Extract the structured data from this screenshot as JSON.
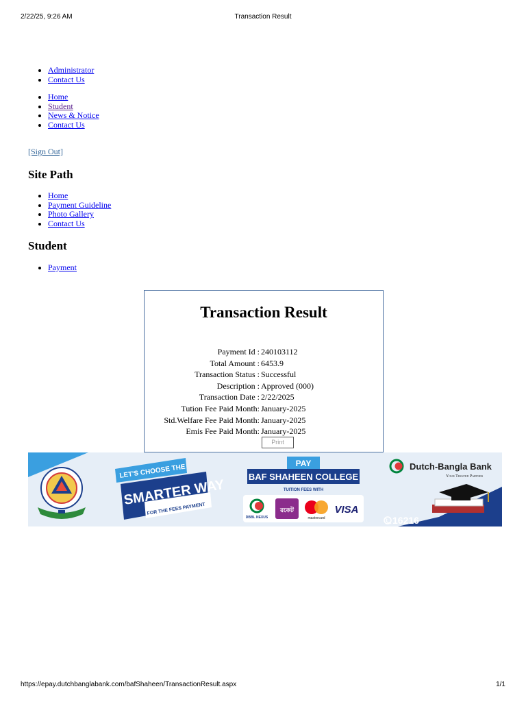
{
  "print_header": {
    "datetime": "2/22/25, 9:26 AM",
    "title": "Transaction Result"
  },
  "top_links": [
    "Administrator",
    "Contact Us"
  ],
  "main_menu": [
    "Home",
    "Student",
    "News & Notice",
    "Contact Us"
  ],
  "sign_out": "[Sign Out]",
  "site_path": {
    "heading": "Site Path",
    "items": [
      "Home",
      "Payment Guideline",
      "Photo Gallery",
      "Contact Us"
    ]
  },
  "student": {
    "heading": "Student",
    "items": [
      "Payment"
    ]
  },
  "transaction": {
    "title": "Transaction Result",
    "rows": [
      {
        "label": "Payment Id :",
        "value": "240103112"
      },
      {
        "label": "Total Amount :",
        "value": "6453.9"
      },
      {
        "label": "Transaction Status :",
        "value": "Successful"
      },
      {
        "label": "Description :",
        "value": "Approved (000)"
      },
      {
        "label": "Transaction Date :",
        "value": "2/22/2025"
      },
      {
        "label": "Tution Fee Paid Month:",
        "value": "January-2025"
      },
      {
        "label": "Std.Welfare Fee Paid Month:",
        "value": "January-2025"
      },
      {
        "label": "Emis Fee Paid Month:",
        "value": "January-2025"
      }
    ],
    "print_label": "Print"
  },
  "banner": {
    "lets_choose": "LET'S CHOOSE THE",
    "smarter_way": "SMARTER WAY",
    "for_fees": "FOR THE FEES PAYMENT",
    "pay": "PAY",
    "college": "BAF SHAHEEN COLLEGE",
    "tuition_with": "TUITION FEES WITH",
    "dbbl_nexus": "DBBL NEXUS",
    "rocket": "রকেট",
    "mastercard": "mastercard",
    "visa": "VISA",
    "bank_name": "Dutch-Bangla Bank",
    "tagline": "Your Trusted Partner",
    "hotline": "16216",
    "colors": {
      "navy": "#1c3f8c",
      "sky": "#3a9fe0",
      "brand_green": "#00843d"
    }
  },
  "print_footer": {
    "url": "https://epay.dutchbanglabank.com/bafShaheen/TransactionResult.aspx",
    "page": "1/1"
  }
}
